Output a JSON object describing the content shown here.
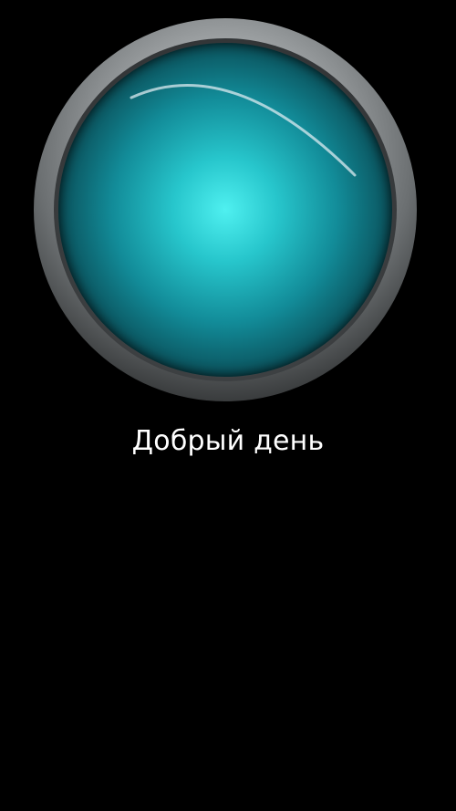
{
  "orb": {
    "icon": "glowing-orb",
    "glow_color": "#4ff0f0",
    "bezel_color": "#a9adaf"
  },
  "greeting": {
    "text": "Добрый день"
  }
}
